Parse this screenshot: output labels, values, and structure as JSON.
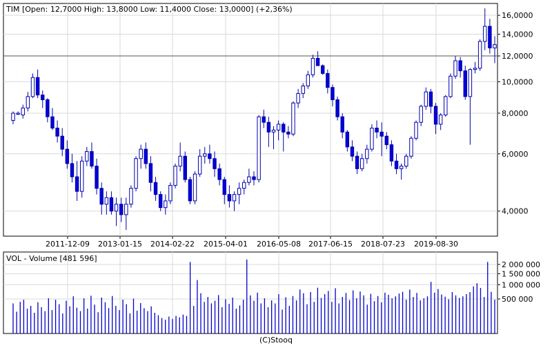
{
  "chart_data": [
    {
      "type": "candlestick",
      "symbol": "TIM",
      "ohlc_summary": "TIM [Open: 12,7000  High: 13,8000  Low: 11,4000  Close: 13,0000] (+2,36%)",
      "last": {
        "open": 12.7,
        "high": 13.8,
        "low": 11.4,
        "close": 13.0,
        "change_pct": 2.36
      },
      "scale": "log",
      "ylim": [
        3.35,
        17.4
      ],
      "y_ticks": [
        4,
        6,
        8,
        10,
        12,
        14,
        16
      ],
      "y_tick_labels": [
        "4,0000",
        "6,0000",
        "8,0000",
        "10,0000",
        "12,0000",
        "14,0000",
        "16,0000"
      ],
      "reference_line": 12.0,
      "x_tick_labels": [
        "2011-12-09",
        "2013-01-15",
        "2014-02-22",
        "2015-04-01",
        "2016-05-08",
        "2017-06-15",
        "2018-07-23",
        "2019-08-30"
      ],
      "up_color": "#ffffff",
      "down_color": "#0000dd",
      "wick_color": "#0000aa",
      "grid": true,
      "candles": [
        [
          7.6,
          8.1,
          7.4,
          8.0
        ],
        [
          8.0,
          8.1,
          7.9,
          8.0
        ],
        [
          7.9,
          8.5,
          7.7,
          8.3
        ],
        [
          8.3,
          9.3,
          8.1,
          9.0
        ],
        [
          9.0,
          10.6,
          8.9,
          10.3
        ],
        [
          10.3,
          10.9,
          8.9,
          9.1
        ],
        [
          9.1,
          9.4,
          8.3,
          8.8
        ],
        [
          8.8,
          8.9,
          7.5,
          7.8
        ],
        [
          7.8,
          8.3,
          7.1,
          7.2
        ],
        [
          7.2,
          7.6,
          6.5,
          6.8
        ],
        [
          6.8,
          7.2,
          5.9,
          6.2
        ],
        [
          6.2,
          6.6,
          5.4,
          5.6
        ],
        [
          5.6,
          6.0,
          4.9,
          5.1
        ],
        [
          5.1,
          5.7,
          4.3,
          4.6
        ],
        [
          4.6,
          5.9,
          4.4,
          5.7
        ],
        [
          5.7,
          6.3,
          5.5,
          6.1
        ],
        [
          6.1,
          6.5,
          5.4,
          5.5
        ],
        [
          5.5,
          5.8,
          4.5,
          4.7
        ],
        [
          4.7,
          4.9,
          3.9,
          4.2
        ],
        [
          4.2,
          4.6,
          3.9,
          4.4
        ],
        [
          4.4,
          4.6,
          3.9,
          4.0
        ],
        [
          4.0,
          4.4,
          3.6,
          4.2
        ],
        [
          4.2,
          4.4,
          3.7,
          3.9
        ],
        [
          3.9,
          4.4,
          3.5,
          4.2
        ],
        [
          4.2,
          4.8,
          4.1,
          4.7
        ],
        [
          4.7,
          5.9,
          4.6,
          5.8
        ],
        [
          5.8,
          6.4,
          5.4,
          6.2
        ],
        [
          6.2,
          6.5,
          5.4,
          5.6
        ],
        [
          5.6,
          5.9,
          4.6,
          4.9
        ],
        [
          4.9,
          5.1,
          4.3,
          4.5
        ],
        [
          4.5,
          4.6,
          4.0,
          4.1
        ],
        [
          4.1,
          4.5,
          3.9,
          4.3
        ],
        [
          4.3,
          4.9,
          4.2,
          4.8
        ],
        [
          4.8,
          5.6,
          4.7,
          5.5
        ],
        [
          5.5,
          6.5,
          5.3,
          5.9
        ],
        [
          5.9,
          6.1,
          4.9,
          5.0
        ],
        [
          5.0,
          5.1,
          4.2,
          4.3
        ],
        [
          4.3,
          5.3,
          4.2,
          5.2
        ],
        [
          5.2,
          6.2,
          5.1,
          5.9
        ],
        [
          5.9,
          6.3,
          5.6,
          6.0
        ],
        [
          6.0,
          6.4,
          5.6,
          5.8
        ],
        [
          5.8,
          6.1,
          5.1,
          5.4
        ],
        [
          5.4,
          5.6,
          4.8,
          5.0
        ],
        [
          5.0,
          5.1,
          4.2,
          4.5
        ],
        [
          4.5,
          4.8,
          4.1,
          4.3
        ],
        [
          4.3,
          4.6,
          4.0,
          4.5
        ],
        [
          4.5,
          4.9,
          4.2,
          4.7
        ],
        [
          4.7,
          5.0,
          4.5,
          4.9
        ],
        [
          4.9,
          5.4,
          4.8,
          5.1
        ],
        [
          5.1,
          5.3,
          4.8,
          5.0
        ],
        [
          5.0,
          7.9,
          4.9,
          7.8
        ],
        [
          7.8,
          8.2,
          7.2,
          7.5
        ],
        [
          7.5,
          7.8,
          6.3,
          7.0
        ],
        [
          7.0,
          7.3,
          6.2,
          7.1
        ],
        [
          7.1,
          7.6,
          6.6,
          7.4
        ],
        [
          7.4,
          7.5,
          6.1,
          7.0
        ],
        [
          7.0,
          7.3,
          6.7,
          6.9
        ],
        [
          6.9,
          8.7,
          6.8,
          8.6
        ],
        [
          8.6,
          9.5,
          8.3,
          9.2
        ],
        [
          9.2,
          9.9,
          8.9,
          9.7
        ],
        [
          9.7,
          10.8,
          9.5,
          10.5
        ],
        [
          10.5,
          12.1,
          10.3,
          11.8
        ],
        [
          11.8,
          12.4,
          11.4,
          11.2
        ],
        [
          11.2,
          11.3,
          10.5,
          10.6
        ],
        [
          10.6,
          10.9,
          9.2,
          9.6
        ],
        [
          9.6,
          9.8,
          8.4,
          8.8
        ],
        [
          8.8,
          9.0,
          7.6,
          7.8
        ],
        [
          7.8,
          8.0,
          6.7,
          7.0
        ],
        [
          7.0,
          7.1,
          6.1,
          6.3
        ],
        [
          6.3,
          6.6,
          5.7,
          5.9
        ],
        [
          5.9,
          6.1,
          5.2,
          5.4
        ],
        [
          5.4,
          6.0,
          5.3,
          5.8
        ],
        [
          5.8,
          6.4,
          5.6,
          6.2
        ],
        [
          6.2,
          7.4,
          6.1,
          7.2
        ],
        [
          7.2,
          7.6,
          6.7,
          7.0
        ],
        [
          7.0,
          7.5,
          5.9,
          6.8
        ],
        [
          6.8,
          7.0,
          6.2,
          6.4
        ],
        [
          6.4,
          6.6,
          5.5,
          5.7
        ],
        [
          5.7,
          6.0,
          5.2,
          5.4
        ],
        [
          5.4,
          5.6,
          5.0,
          5.5
        ],
        [
          5.5,
          6.0,
          5.4,
          5.9
        ],
        [
          5.9,
          6.8,
          5.8,
          6.7
        ],
        [
          6.7,
          7.6,
          6.6,
          7.5
        ],
        [
          7.5,
          8.5,
          7.3,
          8.4
        ],
        [
          8.4,
          9.6,
          8.2,
          9.3
        ],
        [
          9.3,
          9.5,
          8.0,
          8.4
        ],
        [
          8.4,
          8.6,
          6.9,
          7.4
        ],
        [
          7.4,
          8.0,
          7.1,
          7.9
        ],
        [
          7.9,
          9.1,
          7.8,
          9.0
        ],
        [
          9.0,
          10.6,
          8.9,
          10.4
        ],
        [
          10.4,
          12.0,
          10.2,
          11.6
        ],
        [
          11.6,
          11.9,
          10.3,
          10.8
        ],
        [
          10.8,
          11.2,
          8.8,
          9.0
        ],
        [
          9.0,
          11.0,
          6.4,
          10.9
        ],
        [
          10.9,
          11.5,
          10.6,
          11.0
        ],
        [
          11.0,
          13.5,
          10.8,
          13.3
        ],
        [
          13.3,
          16.8,
          12.5,
          14.8
        ],
        [
          14.8,
          15.6,
          12.2,
          12.7
        ],
        [
          12.7,
          13.8,
          11.4,
          13.0
        ]
      ]
    },
    {
      "type": "bar",
      "title": "VOL - Volume [481 596]",
      "last_volume": 481596,
      "scale": "sqrt",
      "ylim": [
        0,
        2600000
      ],
      "y_ticks": [
        500000,
        1000000,
        1500000,
        2000000
      ],
      "y_tick_labels": [
        "500 000",
        "1 000 000",
        "1 500 000",
        "2 000 000"
      ],
      "bar_color": "#0000cc",
      "values": [
        380000,
        200000,
        420000,
        480000,
        260000,
        320000,
        180000,
        410000,
        290000,
        210000,
        520000,
        230000,
        480000,
        360000,
        170000,
        450000,
        310000,
        580000,
        280000,
        210000,
        520000,
        260000,
        600000,
        350000,
        190000,
        540000,
        410000,
        270000,
        590000,
        320000,
        230000,
        480000,
        360000,
        170000,
        510000,
        220000,
        390000,
        270000,
        210000,
        310000,
        180000,
        140000,
        100000,
        80000,
        120000,
        90000,
        130000,
        110000,
        150000,
        130000,
        2150000,
        320000,
        1200000,
        680000,
        420000,
        560000,
        380000,
        450000,
        620000,
        290000,
        490000,
        370000,
        540000,
        260000,
        330000,
        480000,
        2300000,
        610000,
        450000,
        700000,
        380000,
        520000,
        290000,
        460000,
        380000,
        650000,
        240000,
        550000,
        320000,
        590000,
        460000,
        810000,
        680000,
        360000,
        720000,
        420000,
        880000,
        530000,
        650000,
        760000,
        420000,
        860000,
        380000,
        560000,
        690000,
        470000,
        780000,
        520000,
        740000,
        610000,
        350000,
        660000,
        440000,
        590000,
        410000,
        700000,
        630000,
        520000,
        580000,
        670000,
        730000,
        480000,
        810000,
        560000,
        690000,
        460000,
        520000,
        580000,
        1120000,
        700000,
        830000,
        640000,
        570000,
        490000,
        720000,
        610000,
        530000,
        580000,
        650000,
        720000,
        930000,
        1060000,
        870000,
        560000,
        2150000,
        730000,
        481596
      ]
    }
  ],
  "footer": {
    "copyright": "(C)Stooq"
  }
}
